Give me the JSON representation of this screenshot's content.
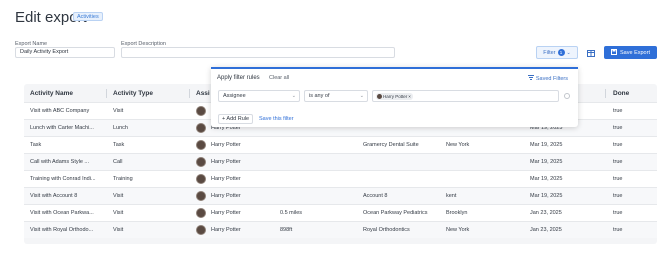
{
  "header": {
    "title": "Edit export",
    "badge": "Activities"
  },
  "form": {
    "export_name_label": "Export Name",
    "export_name_value": "Daily Activity Export",
    "export_description_label": "Export Description",
    "export_description_value": ""
  },
  "toolbar": {
    "filter_label": "Filter",
    "filter_count": "1",
    "save_export_label": "Save Export"
  },
  "filter_popover": {
    "title": "Apply filter rules",
    "clear_all": "Clear all",
    "saved_filters": "Saved Filters",
    "rule": {
      "field": "Assignee",
      "operator": "is any of",
      "value_chip": "Harry Potter"
    },
    "add_rule": "+ Add Rule",
    "save_filter": "Save this filter"
  },
  "table": {
    "columns": [
      "Activity Name",
      "Activity Type",
      "Assi",
      "",
      "",
      "",
      "",
      "Done"
    ],
    "rows": [
      {
        "name": "Visit with ABC Company",
        "type": "Visit",
        "assignee": "",
        "distance": "",
        "account": "",
        "city": "",
        "date": "",
        "done": "true"
      },
      {
        "name": "Lunch with Carter Machi...",
        "type": "Lunch",
        "assignee": "Harry Potter",
        "distance": "",
        "account": "",
        "city": "",
        "date": "Mar 19, 2025",
        "done": "true"
      },
      {
        "name": "Task",
        "type": "Task",
        "assignee": "Harry Potter",
        "distance": "",
        "account": "Gramercy Dental Suite",
        "city": "New York",
        "date": "Mar 19, 2025",
        "done": "true"
      },
      {
        "name": "Call with Adams Style ...",
        "type": "Call",
        "assignee": "Harry Potter",
        "distance": "",
        "account": "",
        "city": "",
        "date": "Mar 19, 2025",
        "done": "true"
      },
      {
        "name": "Training with Conrad Indi...",
        "type": "Training",
        "assignee": "Harry Potter",
        "distance": "",
        "account": "",
        "city": "",
        "date": "Mar 19, 2025",
        "done": "true"
      },
      {
        "name": "Visit with Account 8",
        "type": "Visit",
        "assignee": "Harry Potter",
        "distance": "",
        "account": "Account 8",
        "city": "kent",
        "date": "Mar 19, 2025",
        "done": "true"
      },
      {
        "name": "Visit with Ocean Parkwa...",
        "type": "Visit",
        "assignee": "Harry Potter",
        "distance": "0.5 miles",
        "account": "Ocean Parkway Pediatrics",
        "city": "Brooklyn",
        "date": "Jan 23, 2025",
        "done": "true"
      },
      {
        "name": "Visit with Royal Orthodo...",
        "type": "Visit",
        "assignee": "Harry Potter",
        "distance": "898ft",
        "account": "Royal Orthodontics",
        "city": "New York",
        "date": "Jan 23, 2025",
        "done": "true"
      }
    ]
  },
  "colors": {
    "accent": "#2f6fd8",
    "text": "#333a44"
  },
  "icons": [
    "filter-icon",
    "chevron-down-icon",
    "columns-icon",
    "save-icon",
    "saved-filters-icon",
    "avatar",
    "close-icon",
    "remove-circle-icon"
  ]
}
